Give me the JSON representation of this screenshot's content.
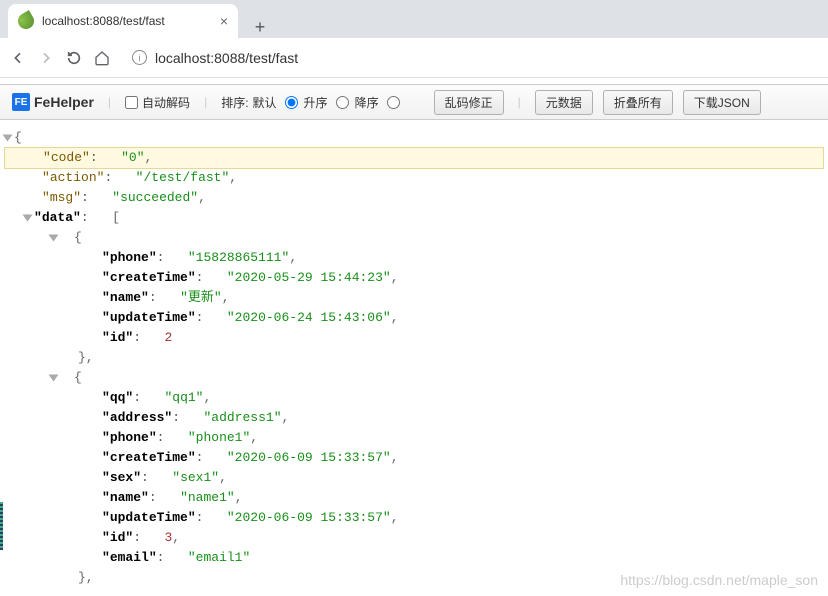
{
  "browser": {
    "tab_title": "localhost:8088/test/fast",
    "url_display": "localhost:8088/test/fast"
  },
  "fehelper": {
    "brand": "FeHelper",
    "auto_decode": "自动解码",
    "sort_label": "排序:",
    "sort_default": "默认",
    "sort_asc": "升序",
    "sort_desc": "降序",
    "btn_fix": "乱码修正",
    "btn_meta": "元数据",
    "btn_collapse": "折叠所有",
    "btn_download": "下载JSON"
  },
  "json": {
    "code_k": "code",
    "code_v": "0",
    "action_k": "action",
    "action_v": "/test/fast",
    "msg_k": "msg",
    "msg_v": "succeeded",
    "data_k": "data",
    "items": [
      {
        "phone_k": "phone",
        "phone_v": "15828865111",
        "createTime_k": "createTime",
        "createTime_v": "2020-05-29 15:44:23",
        "name_k": "name",
        "name_v": "更新",
        "updateTime_k": "updateTime",
        "updateTime_v": "2020-06-24 15:43:06",
        "id_k": "id",
        "id_v": 2
      },
      {
        "qq_k": "qq",
        "qq_v": "qq1",
        "address_k": "address",
        "address_v": "address1",
        "phone_k": "phone",
        "phone_v": "phone1",
        "createTime_k": "createTime",
        "createTime_v": "2020-06-09 15:33:57",
        "sex_k": "sex",
        "sex_v": "sex1",
        "name_k": "name",
        "name_v": "name1",
        "updateTime_k": "updateTime",
        "updateTime_v": "2020-06-09 15:33:57",
        "id_k": "id",
        "id_v": 3,
        "email_k": "email",
        "email_v": "email1"
      }
    ]
  },
  "watermark": "https://blog.csdn.net/maple_son"
}
